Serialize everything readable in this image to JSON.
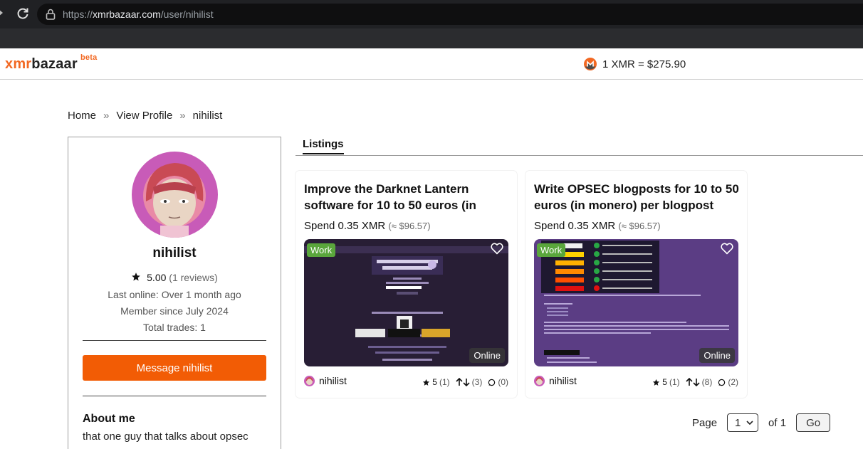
{
  "browser": {
    "url_scheme": "https://",
    "url_host": "xmrbazaar.com",
    "url_path": "/user/nihilist"
  },
  "header": {
    "logo_xmr": "xmr",
    "logo_bazaar": "bazaar",
    "logo_beta": "beta",
    "rate_text": "1 XMR = $275.90"
  },
  "breadcrumb": {
    "home": "Home",
    "view_profile": "View Profile",
    "current": "nihilist",
    "separator": "»"
  },
  "profile": {
    "name": "nihilist",
    "rating": "5.00",
    "reviews": "(1 reviews)",
    "last_online": "Last online: Over 1 month ago",
    "member_since": "Member since July 2024",
    "total_trades": "Total trades: 1",
    "message_button": "Message nihilist",
    "about_title": "About me",
    "about_text": "that one guy that talks about opsec"
  },
  "tabs": {
    "listings": "Listings"
  },
  "listings": [
    {
      "title": "Improve the Darknet Lantern software for 10 to 50 euros (in",
      "price": "Spend 0.35 XMR",
      "price_usd": "(≈ $96.57)",
      "badge": "Work",
      "status": "Online",
      "seller": "nihilist",
      "rating": "5",
      "rating_count": "(1)",
      "trades": "(3)",
      "comments": "(0)"
    },
    {
      "title": "Write OPSEC blogposts for 10 to 50 euros (in monero) per blogpost",
      "price": "Spend 0.35 XMR",
      "price_usd": "(≈ $96.57)",
      "badge": "Work",
      "status": "Online",
      "seller": "nihilist",
      "rating": "5",
      "rating_count": "(1)",
      "trades": "(8)",
      "comments": "(2)"
    }
  ],
  "pagination": {
    "page_label": "Page",
    "current_page": "1",
    "of_label": "of 1",
    "go_label": "Go"
  },
  "colors": {
    "accent": "#f26822",
    "button": "#f25c05",
    "work_badge": "#5aa63c"
  }
}
